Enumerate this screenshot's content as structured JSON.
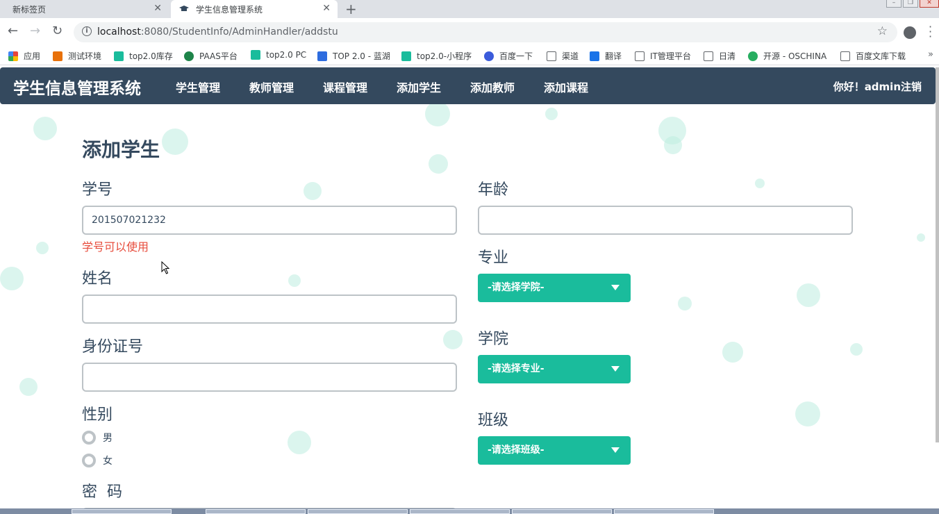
{
  "browser": {
    "tabs": [
      {
        "title": "新标签页",
        "active": false
      },
      {
        "title": "学生信息管理系统",
        "active": true
      }
    ],
    "url_host": "localhost",
    "url_rest": ":8080/StudentInfo/AdminHandler/addstu",
    "bookmarks": [
      {
        "label": "应用",
        "color": "#e8453c"
      },
      {
        "label": "测试环境",
        "color": "#e8710a"
      },
      {
        "label": "top2.0库存",
        "color": "#1abc9c"
      },
      {
        "label": "PAAS平台",
        "color": "#1e8449"
      },
      {
        "label": "top2.0 PC",
        "color": "#1abc9c"
      },
      {
        "label": "TOP 2.0 - 蓝湖",
        "color": "#2d6cdf"
      },
      {
        "label": "top2.0-小程序",
        "color": "#1abc9c"
      },
      {
        "label": "百度一下",
        "color": "#3b5bdb"
      },
      {
        "label": "渠道",
        "color": "#ffffff"
      },
      {
        "label": "翻译",
        "color": "#1a73e8"
      },
      {
        "label": "IT管理平台",
        "color": "#ffffff"
      },
      {
        "label": "日清",
        "color": "#ffffff"
      },
      {
        "label": "开源 - OSCHINA",
        "color": "#27ae60"
      },
      {
        "label": "百度文库下载",
        "color": "#ffffff"
      }
    ],
    "more": "»"
  },
  "nav": {
    "brand": "学生信息管理系统",
    "links": [
      "学生管理",
      "教师管理",
      "课程管理",
      "添加学生",
      "添加教师",
      "添加课程"
    ],
    "greeting": "你好！admin注销"
  },
  "form": {
    "title": "添加学生",
    "student_id_label": "学号",
    "student_id_value": "201507021232",
    "student_id_msg": "学号可以使用",
    "name_label": "姓名",
    "id_card_label": "身份证号",
    "gender_label": "性别",
    "gender_options": [
      "男",
      "女"
    ],
    "password_label": "密  码",
    "age_label": "年龄",
    "major_label": "专业",
    "major_select": "-请选择学院-",
    "college_label": "学院",
    "college_select": "-请选择专业-",
    "class_label": "班级",
    "class_select": "-请选择班级-"
  },
  "colors": {
    "navbar": "#34495e",
    "accent": "#1abc9c",
    "error": "#e74c3c"
  }
}
